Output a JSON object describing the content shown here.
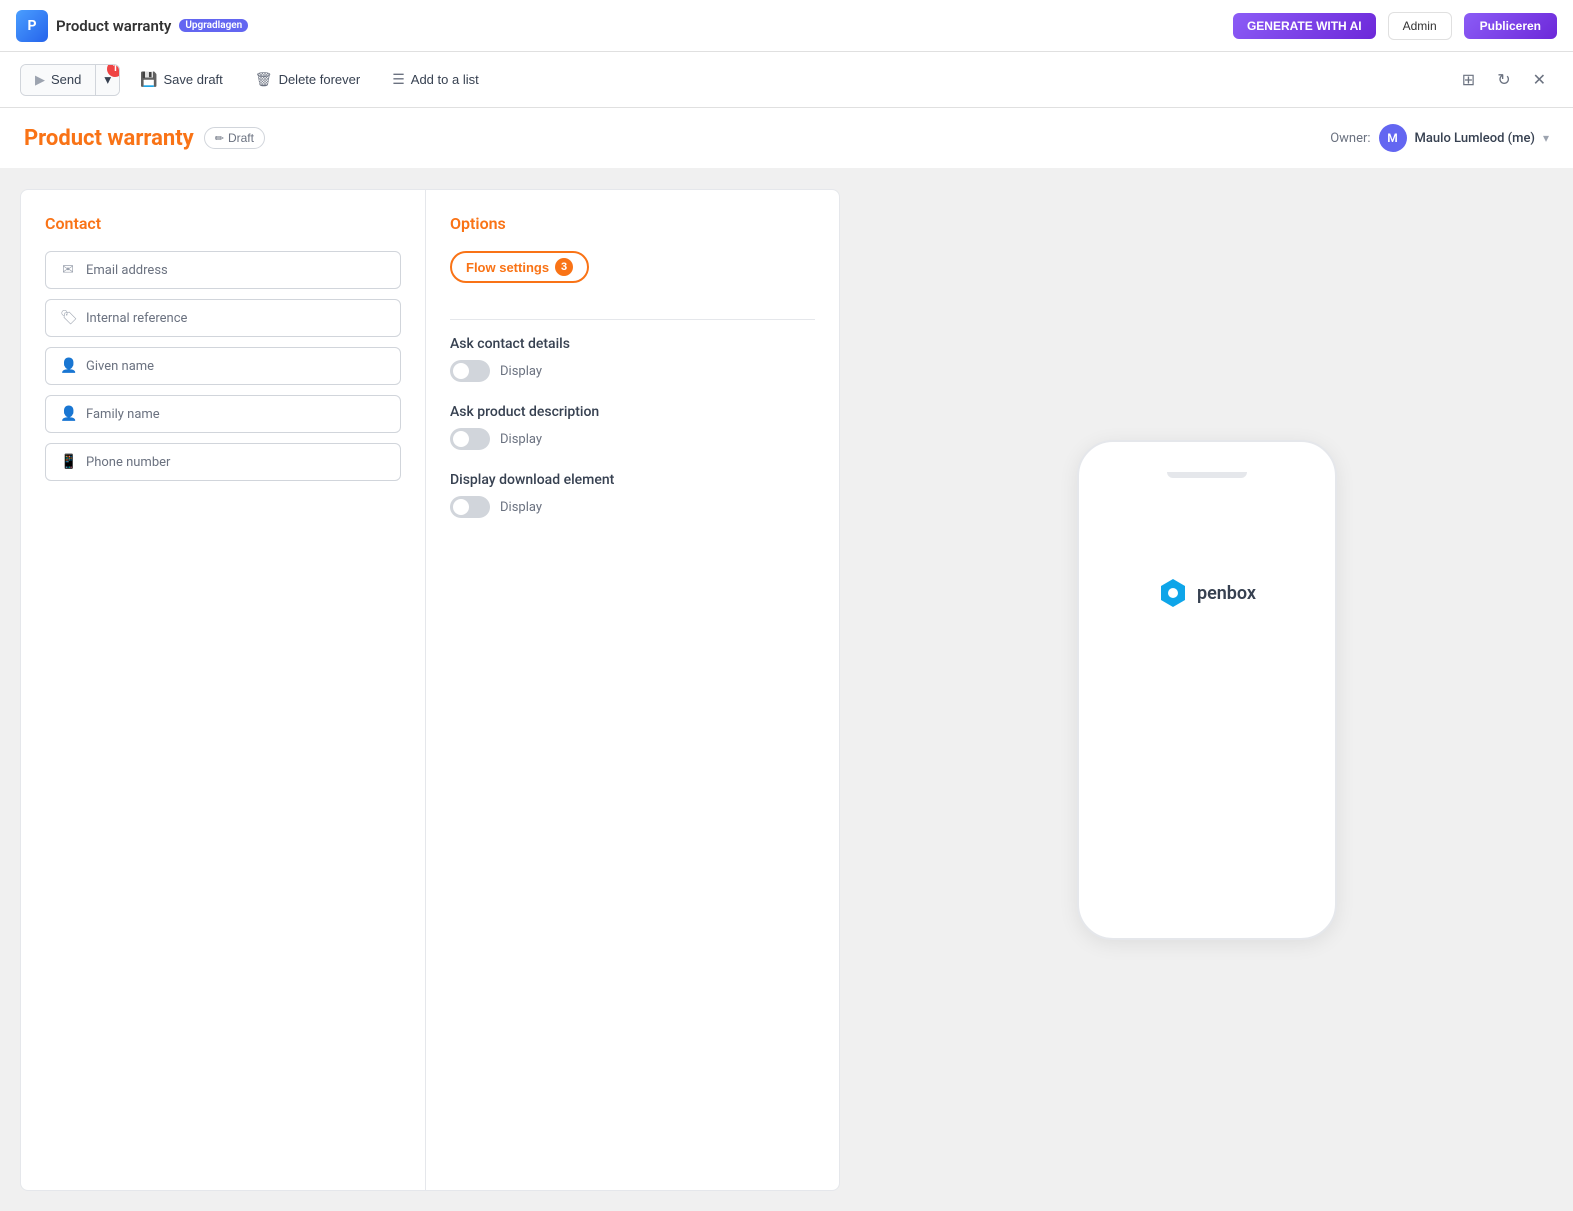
{
  "topnav": {
    "logo_text": "P",
    "app_name": "Product warranty",
    "upgrade_badge": "Upgradlagen",
    "generate_btn": "GENERATE WITH AI",
    "user_btn": "Admin",
    "publish_btn": "Publiceren"
  },
  "toolbar": {
    "send_label": "Send",
    "notification_count": "1",
    "save_draft_label": "Save draft",
    "delete_forever_label": "Delete forever",
    "add_to_list_label": "Add to a list"
  },
  "page_header": {
    "title": "Product warranty",
    "draft_label": "Draft",
    "owner_prefix": "Owner:",
    "owner_name": "Maulo Lumleod (me)",
    "owner_initial": "M"
  },
  "contact_section": {
    "title": "Contact",
    "fields": [
      {
        "icon": "✉",
        "label": "Email address",
        "name": "email-field"
      },
      {
        "icon": "🏷",
        "label": "Internal reference",
        "name": "internal-reference-field"
      },
      {
        "icon": "👤",
        "label": "Given name",
        "name": "given-name-field"
      },
      {
        "icon": "👤",
        "label": "Family name",
        "name": "family-name-field"
      },
      {
        "icon": "📱",
        "label": "Phone number",
        "name": "phone-number-field"
      }
    ]
  },
  "options_section": {
    "title": "Options",
    "flow_settings_label": "Flow settings",
    "flow_settings_count": "3",
    "options": [
      {
        "label": "Ask contact details",
        "toggle_label": "Display",
        "checked": false,
        "name": "ask-contact-details"
      },
      {
        "label": "Ask product description",
        "toggle_label": "Display",
        "checked": false,
        "name": "ask-product-description"
      },
      {
        "label": "Display download element",
        "toggle_label": "Display",
        "checked": false,
        "name": "display-download-element"
      }
    ]
  },
  "preview": {
    "penbox_logo_text": "penbox"
  },
  "icons": {
    "settings_icon": "⚙",
    "refresh_icon": "↻",
    "close_icon": "✕",
    "pencil_icon": "✏",
    "trash_icon": "🗑",
    "list_icon": "☰",
    "chevron_down": "▾",
    "send_arrow": "▶"
  }
}
